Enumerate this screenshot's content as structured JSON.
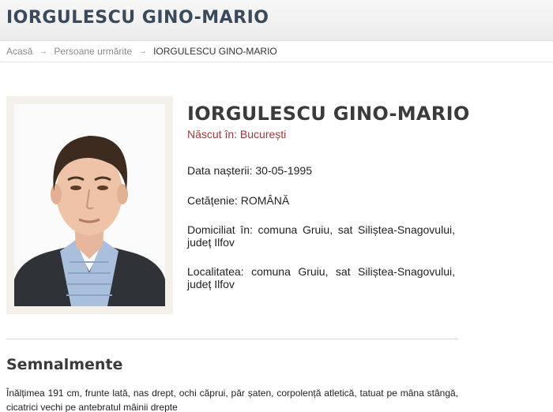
{
  "header": {
    "title": "IORGULESCU GINO-MARIO"
  },
  "breadcrumb": {
    "home": "Acasă",
    "section": "Persoane urmărite",
    "current": "IORGULESCU GINO-MARIO",
    "separator": "→"
  },
  "person": {
    "name": "IORGULESCU GINO-MARIO",
    "birthplace": "Născut în: București",
    "birth_date": "Data nașterii: 30-05-1995",
    "citizenship": "Cetățenie: ROMÂNĂ",
    "domicile": "Domiciliat în: comuna Gruiu, sat Siliștea-Snagovului, județ Ilfov",
    "locality": "Localitatea: comuna Gruiu, sat Siliștea-Snagovului, județ Ilfov"
  },
  "features": {
    "title": "Semnalmente",
    "text": "Înălțimea 191 cm, frunte lată, nas drept, ochi căprui, păr șaten, corpolență atletică, tatuat pe mâna stângă, cicatrici vechi pe antebratul mâinii drepte"
  },
  "colors": {
    "header_text": "#3a4a5c",
    "birthplace": "#9a3a3a",
    "photo_frame": "#f3f1ea"
  }
}
